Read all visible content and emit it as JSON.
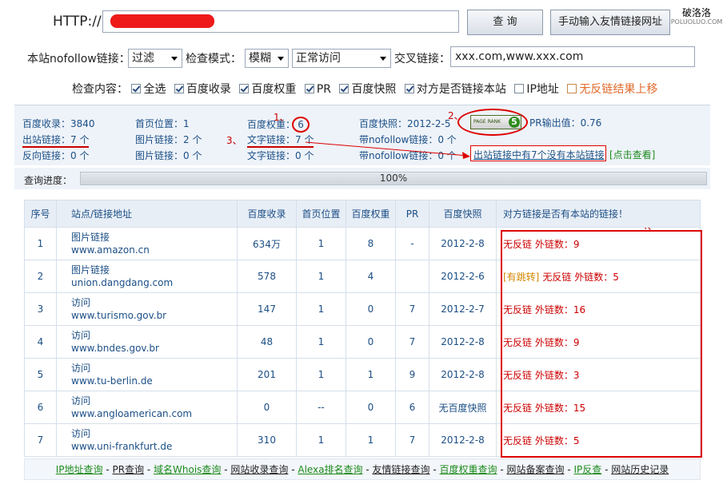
{
  "top": {
    "http_label": "HTTP://",
    "url_value": "",
    "query_btn": "查 询",
    "manual_btn": "手动输入友情链接网址",
    "logo_cn": "破洛洛",
    "logo_en": "POLUOLUO.COM"
  },
  "row2": {
    "nofollow_label": "本站nofollow链接：",
    "nofollow_value": "过滤",
    "mode_label": "检查模式：",
    "mode_value": "模糊",
    "access_value": "正常访问",
    "cross_label": "交叉链接：",
    "cross_value": "xxx.com,www.xxx.com"
  },
  "options": {
    "label": "检查内容：",
    "items": [
      {
        "label": "全选",
        "checked": true
      },
      {
        "label": "百度收录",
        "checked": true
      },
      {
        "label": "百度权重",
        "checked": true
      },
      {
        "label": "PR",
        "checked": true
      },
      {
        "label": "百度快照",
        "checked": true
      },
      {
        "label": "对方是否链接本站",
        "checked": true
      },
      {
        "label": "IP地址",
        "checked": false
      }
    ],
    "special": "无反链结果上移"
  },
  "stats": {
    "c1": [
      "百度收录：",
      "3840",
      "出站链接：",
      "7 个",
      "反向链接：",
      "0 个"
    ],
    "c2": [
      "首页位置：",
      "1",
      "图片链接：",
      "2 个",
      "图片链接：",
      "0 个"
    ],
    "c3": [
      "百度权重：",
      "6",
      "文字链接：",
      "7 个",
      "文字链接：",
      "0 个"
    ],
    "c4": [
      "百度快照：",
      "2012-2-5",
      "带nofollow链接：",
      "0 个",
      "带nofollow链接：",
      "0 个"
    ],
    "pr_badge": "PAGE RANK",
    "pr_num": "5",
    "pr_out": "PR输出值：",
    "pr_out_val": "0.76",
    "note": "出站链接中有7个没有本站链接",
    "note_link": "[点击查看]"
  },
  "annotations": {
    "a1": "1、",
    "a2": "2、",
    "a3": "3、",
    "a4": "4、"
  },
  "progress": {
    "label": "查询进度：",
    "value": "100%"
  },
  "table": {
    "headers": [
      "序号",
      "站点/链接地址",
      "百度收录",
      "首页位置",
      "百度权重",
      "PR",
      "百度快照",
      "对方链接是否有本站的链接！"
    ],
    "rows": [
      {
        "n": "1",
        "type": "图片链接",
        "url": "www.amazon.cn",
        "sl": "634万",
        "pos": "1",
        "qz": "8",
        "pr": "-",
        "kz": "2012-2-8",
        "jump": "",
        "res": "无反链 外链数：9"
      },
      {
        "n": "2",
        "type": "图片链接",
        "url": "union.dangdang.com",
        "sl": "578",
        "pos": "1",
        "qz": "4",
        "pr": "",
        "kz": "2012-2-6",
        "jump": "[有跳转]",
        "res": "无反链 外链数：5"
      },
      {
        "n": "3",
        "type": "访问",
        "url": "www.turismo.gov.br",
        "sl": "147",
        "pos": "1",
        "qz": "0",
        "pr": "7",
        "kz": "2012-2-7",
        "jump": "",
        "res": "无反链 外链数：16"
      },
      {
        "n": "4",
        "type": "访问",
        "url": "www.bndes.gov.br",
        "sl": "48",
        "pos": "1",
        "qz": "0",
        "pr": "7",
        "kz": "2012-2-8",
        "jump": "",
        "res": "无反链 外链数：9"
      },
      {
        "n": "5",
        "type": "访问",
        "url": "www.tu-berlin.de",
        "sl": "201",
        "pos": "1",
        "qz": "1",
        "pr": "9",
        "kz": "2012-2-8",
        "jump": "",
        "res": "无反链 外链数：3"
      },
      {
        "n": "6",
        "type": "访问",
        "url": "www.angloamerican.com",
        "sl": "0",
        "pos": "--",
        "qz": "0",
        "pr": "6",
        "kz": "无百度快照",
        "jump": "",
        "res": "无反链 外链数：15"
      },
      {
        "n": "7",
        "type": "访问",
        "url": "www.uni-frankfurt.de",
        "sl": "310",
        "pos": "1",
        "qz": "1",
        "pr": "7",
        "kz": "2012-2-8",
        "jump": "",
        "res": "无反链 外链数：5"
      }
    ]
  },
  "footer": [
    {
      "t": "IP地址查询",
      "g": true
    },
    {
      "t": "PR查询",
      "g": false
    },
    {
      "t": "域名Whois查询",
      "g": true
    },
    {
      "t": "网站收录查询",
      "g": false
    },
    {
      "t": "Alexa排名查询",
      "g": true
    },
    {
      "t": "友情链接查询",
      "g": false
    },
    {
      "t": "百度权重查询",
      "g": true
    },
    {
      "t": "网站备案查询",
      "g": false
    },
    {
      "t": "IP反查",
      "g": true
    },
    {
      "t": "网站历史记录",
      "g": false
    }
  ]
}
